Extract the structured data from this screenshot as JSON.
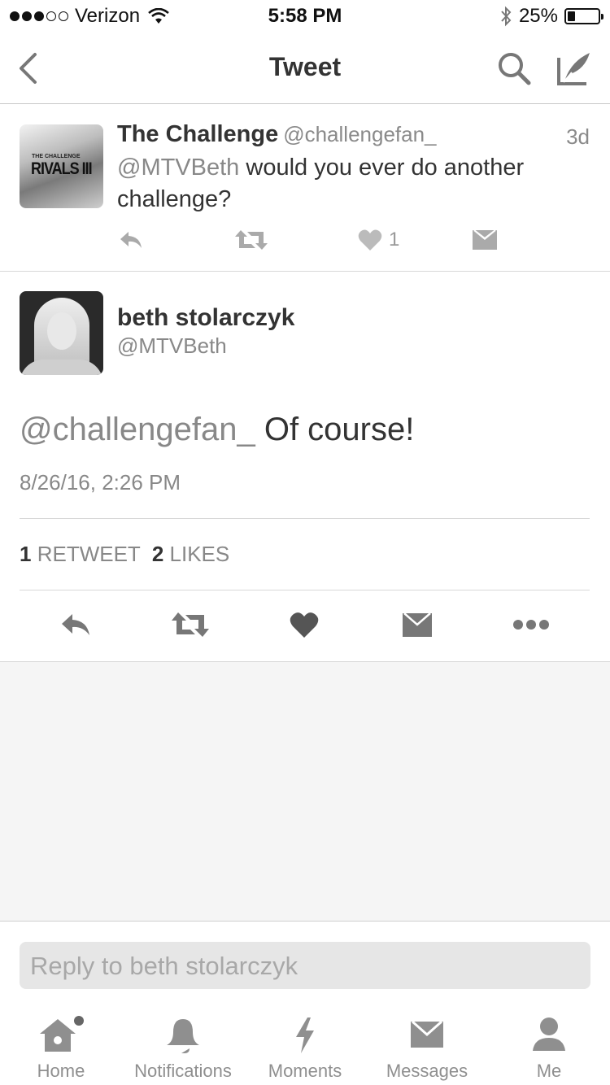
{
  "status_bar": {
    "carrier": "Verizon",
    "time": "5:58 PM",
    "battery": "25%",
    "battery_level": 0.25
  },
  "nav": {
    "title": "Tweet"
  },
  "parent_tweet": {
    "name": "The Challenge",
    "handle": "@challengefan_",
    "age": "3d",
    "mention": "@MTVBeth",
    "text": " would you ever do another challenge?",
    "avatar_caption_small": "THE CHALLENGE",
    "avatar_caption": "RIVALS III",
    "like_count": "1"
  },
  "main_tweet": {
    "name": "beth stolarczyk",
    "handle": "@MTVBeth",
    "mention": "@challengefan_",
    "text": " Of course!",
    "timestamp": "8/26/16, 2:26 PM",
    "retweet_count": "1",
    "retweet_label": "RETWEET",
    "like_count": "2",
    "like_label": "LIKES"
  },
  "reply": {
    "placeholder": "Reply to beth stolarczyk"
  },
  "tabs": [
    {
      "label": "Home",
      "icon": "home-icon"
    },
    {
      "label": "Notifications",
      "icon": "bell-icon"
    },
    {
      "label": "Moments",
      "icon": "lightning-icon"
    },
    {
      "label": "Messages",
      "icon": "envelope-icon"
    },
    {
      "label": "Me",
      "icon": "person-icon"
    }
  ]
}
